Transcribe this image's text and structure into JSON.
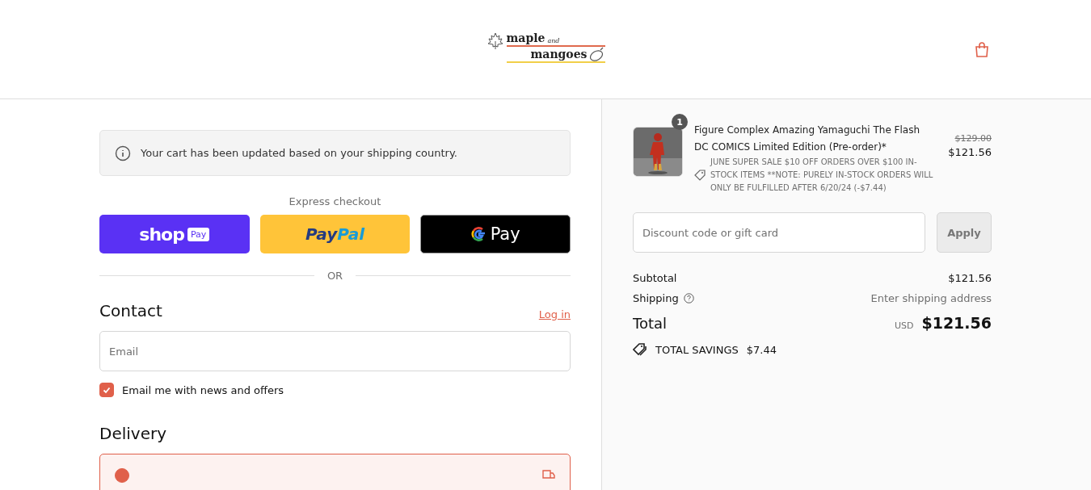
{
  "header": {
    "logo": {
      "line_1": "maple",
      "small": "and",
      "line_2": "mangoes"
    }
  },
  "notice": {
    "text": "Your cart has been updated based on your shipping country."
  },
  "express_checkout": {
    "title": "Express checkout",
    "buttons": [
      {
        "kind": "shop",
        "label": "shop",
        "badge": "Pay"
      },
      {
        "kind": "paypal",
        "label": "Pay",
        "label_2": "Pal"
      },
      {
        "kind": "gpay",
        "label": "Pay"
      }
    ],
    "divider": "OR"
  },
  "contact": {
    "title": "Contact",
    "login_link": "Log in",
    "email": {
      "placeholder": "Email"
    },
    "news_checkbox": {
      "label": "Email me with news and offers",
      "checked": true
    }
  },
  "delivery": {
    "title": "Delivery",
    "options": [
      {
        "selected": true
      }
    ]
  },
  "order": {
    "items": [
      {
        "quantity": "1",
        "name": "Figure Complex Amazing Yamaguchi The Flash DC COMICS Limited Edition (Pre-order)*",
        "discount": "JUNE SUPER SALE $10 OFF ORDERS OVER $100 IN-STOCK ITEMS **NOTE: PURELY IN-STOCK ORDERS WILL ONLY BE FULFILLED AFTER 6/20/24 (-$7.44)",
        "original_price": "$129.00",
        "price": "$121.56"
      }
    ],
    "discount_field": {
      "placeholder": "Discount code or gift card"
    },
    "apply_button": {
      "label": "Apply",
      "disabled": true
    },
    "subtotal": {
      "label": "Subtotal",
      "value": "$121.56"
    },
    "shipping": {
      "label": "Shipping",
      "value": "Enter shipping address"
    },
    "total": {
      "label": "Total",
      "currency": "USD",
      "value": "$121.56"
    },
    "savings": {
      "label": "TOTAL SAVINGS",
      "value": "$7.44"
    }
  }
}
